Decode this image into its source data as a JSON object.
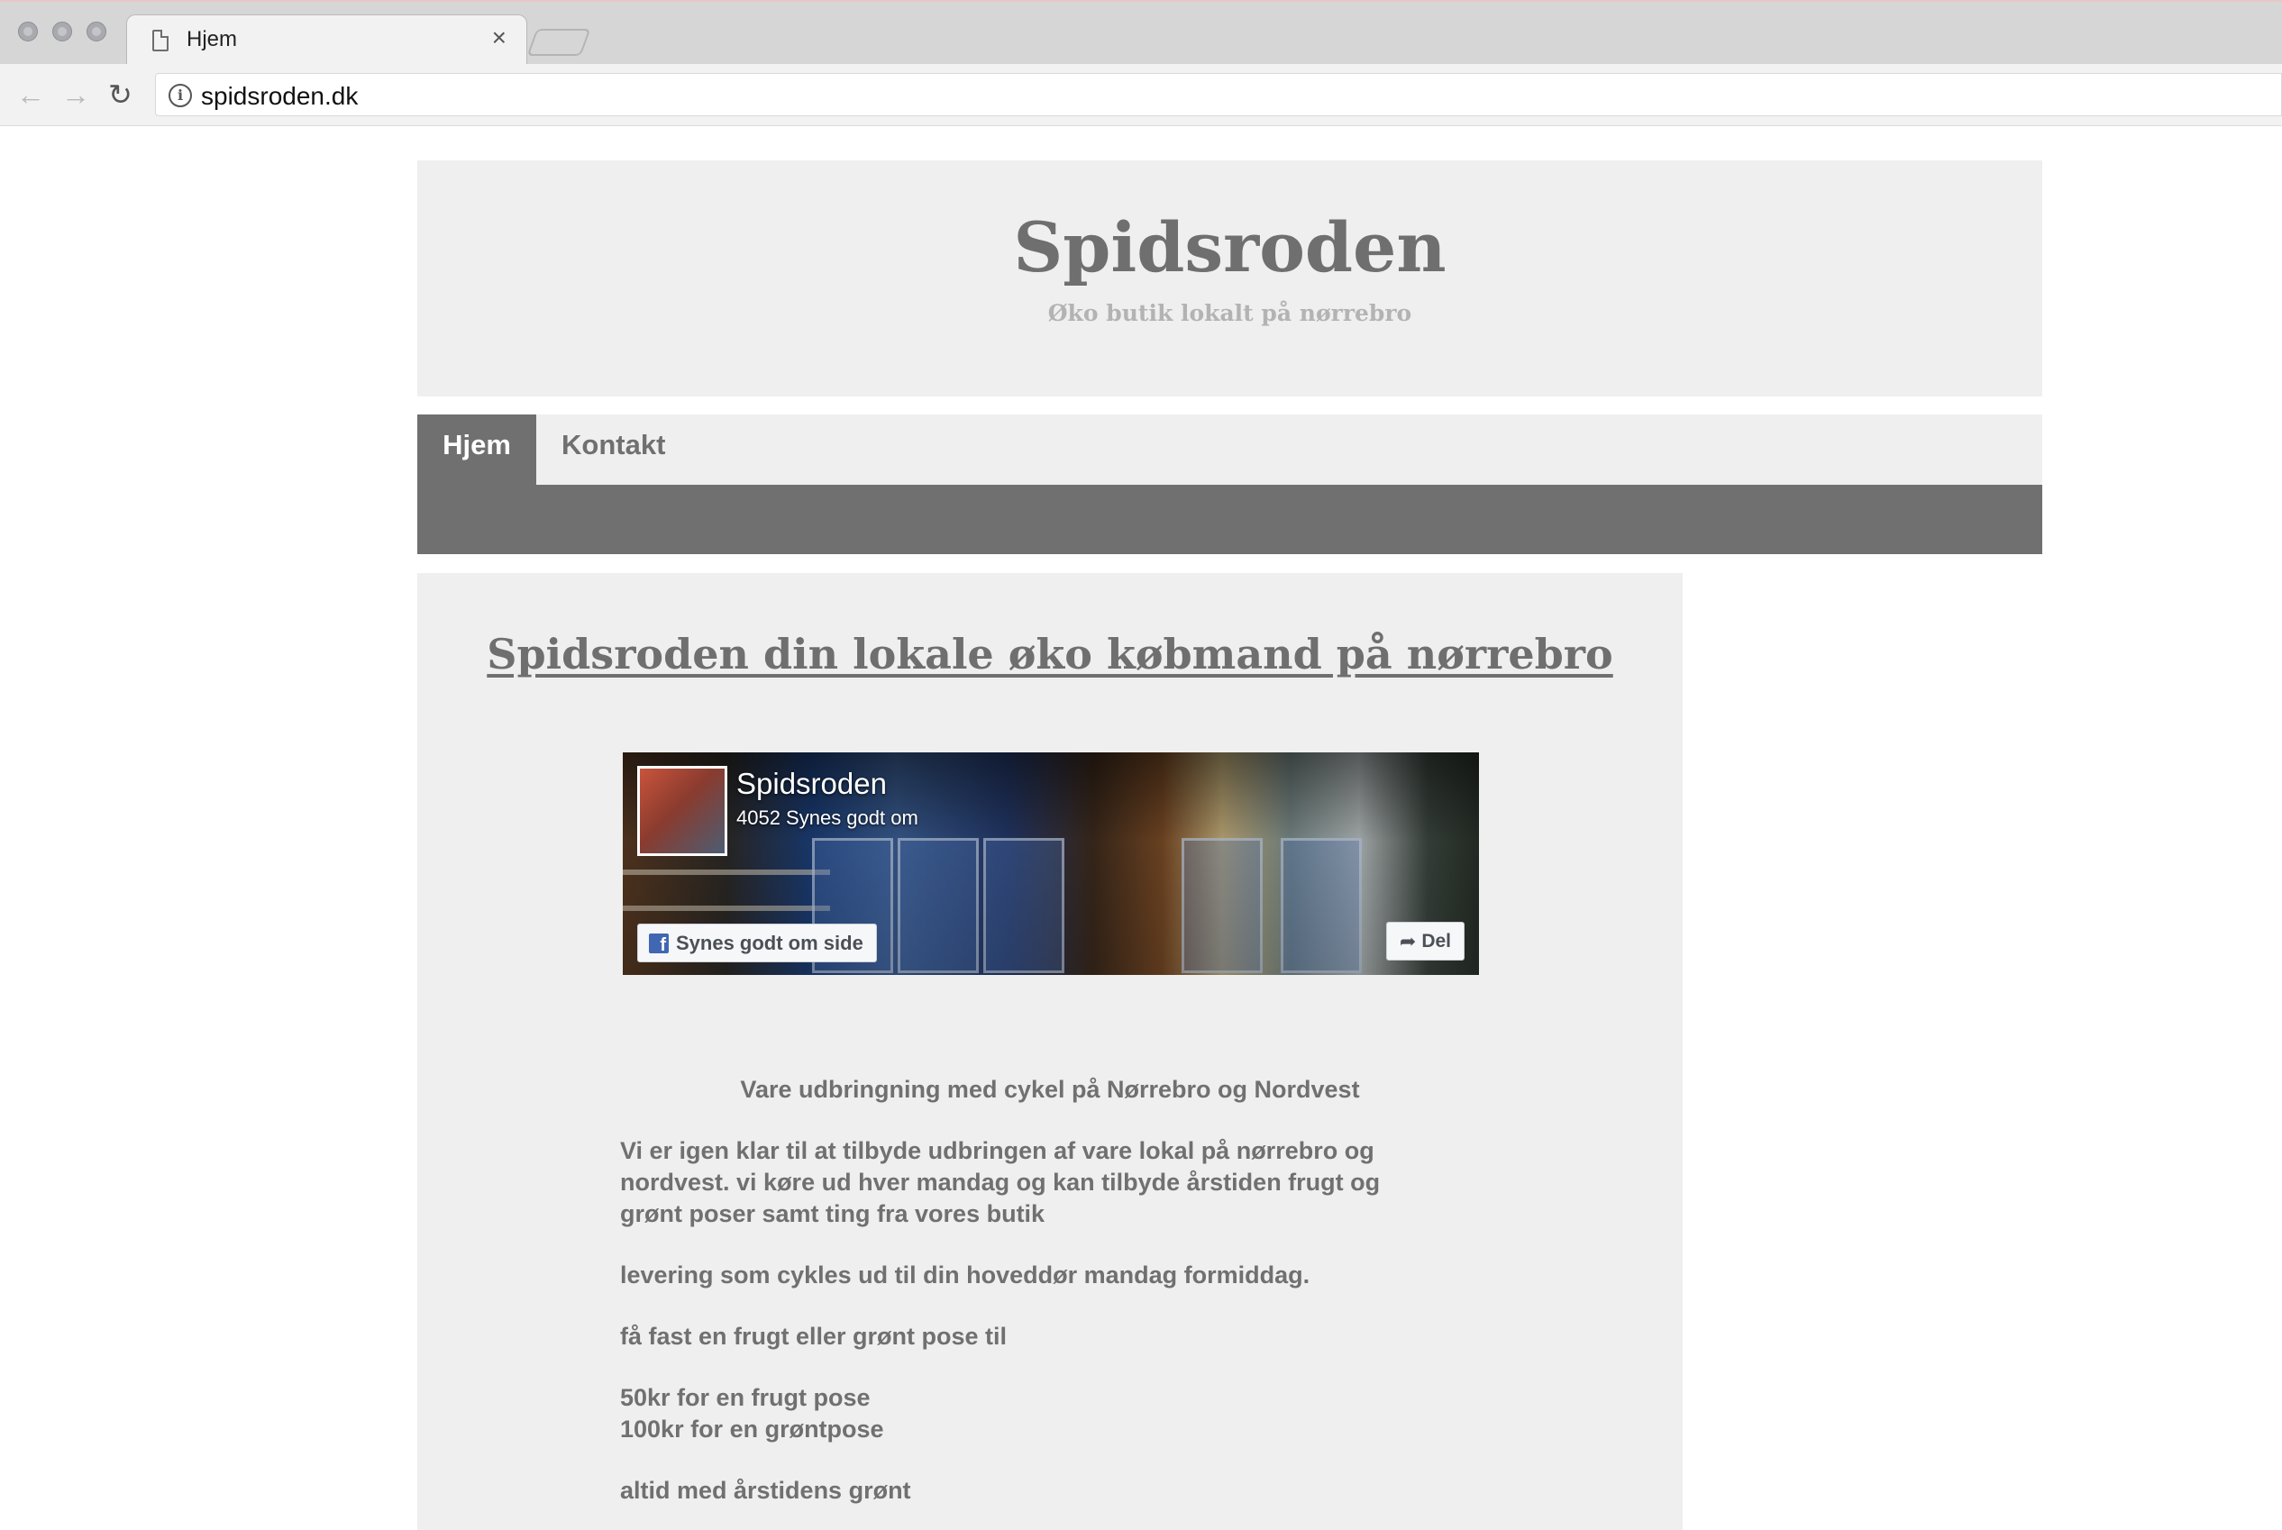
{
  "browser": {
    "tab_title": "Hjem",
    "tab_close": "×",
    "url": "spidsroden.dk",
    "back_glyph": "←",
    "forward_glyph": "→",
    "reload_glyph": "↻",
    "info_glyph": "i"
  },
  "header": {
    "title": "Spidsroden",
    "tagline": "Øko butik lokalt på nørrebro"
  },
  "nav": {
    "items": [
      {
        "label": "Hjem",
        "active": true
      },
      {
        "label": "Kontakt",
        "active": false
      }
    ]
  },
  "main": {
    "heading": "Spidsroden din lokale øko købmand på nørrebro",
    "facebook": {
      "page_name": "Spidsroden",
      "likes": "4052 Synes godt om",
      "logo_glyph": "f",
      "like_button": "Synes godt om side",
      "share_glyph": "➦",
      "share_button": "Del"
    },
    "subheading": "Vare udbringning med cykel på Nørrebro og Nordvest",
    "paragraph1": [
      "Vi er igen klar til at tilbyde udbringen af vare lokal på nørrebro og",
      "nordvest. vi køre ud hver mandag og kan tilbyde årstiden frugt og",
      "grønt poser samt ting fra vores butik"
    ],
    "paragraph2": "levering som cykles ud til din hoveddør mandag formiddag.",
    "paragraph3": "få fast en frugt eller grønt pose til",
    "prices": [
      "50kr for en frugt pose",
      "100kr for en grøntpose"
    ],
    "paragraph4": "altid med årstidens grønt"
  },
  "colors": {
    "accent_gray": "#707070",
    "panel_bg": "#efefef",
    "facebook_blue": "#4267b2"
  }
}
